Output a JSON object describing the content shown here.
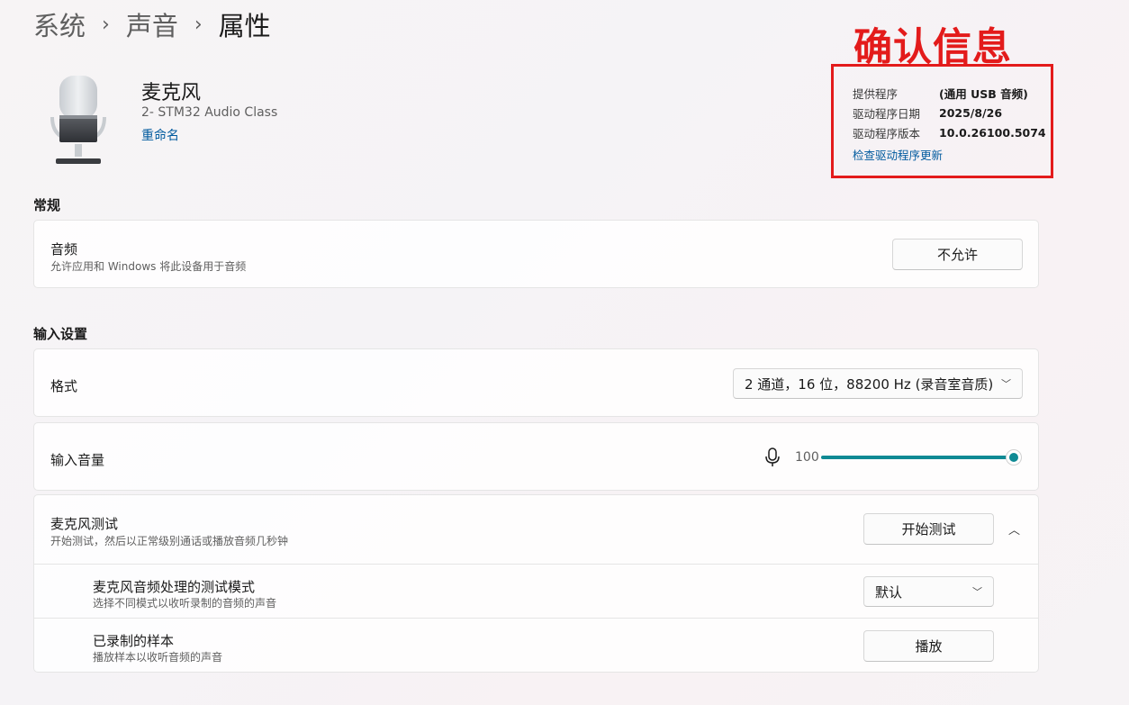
{
  "breadcrumb": [
    "系统",
    "声音",
    "属性"
  ],
  "overlay": {
    "title": "确认信息",
    "color": "#e31b1b"
  },
  "driver_info": {
    "rows": [
      {
        "label": "提供程序",
        "value": "(通用 USB 音频)"
      },
      {
        "label": "驱动程序日期",
        "value": "2025/8/26"
      },
      {
        "label": "驱动程序版本",
        "value": "10.0.26100.5074"
      }
    ],
    "update_link": "检查驱动程序更新"
  },
  "device": {
    "icon": "microphone-device-icon",
    "name": "麦克风",
    "subtitle": "2- STM32 Audio Class",
    "rename_link": "重命名"
  },
  "general": {
    "section_title": "常规",
    "audio": {
      "title": "音频",
      "subtitle": "允许应用和 Windows 将此设备用于音频",
      "button": "不允许"
    }
  },
  "input_settings": {
    "section_title": "输入设置",
    "format": {
      "title": "格式",
      "value": "2 通道，16 位，88200 Hz (录音室音质)"
    },
    "volume": {
      "title": "输入音量",
      "value": "100",
      "level_percent": 100,
      "accent": "#0f8a94"
    },
    "mic_test": {
      "title": "麦克风测试",
      "subtitle": "开始测试，然后以正常级别通话或播放音频几秒钟",
      "button": "开始测试"
    },
    "test_mode": {
      "title": "麦克风音频处理的测试模式",
      "subtitle": "选择不同模式以收听录制的音频的声音",
      "value": "默认"
    },
    "sample": {
      "title": "已录制的样本",
      "subtitle": "播放样本以收听音频的声音",
      "button": "播放"
    }
  }
}
